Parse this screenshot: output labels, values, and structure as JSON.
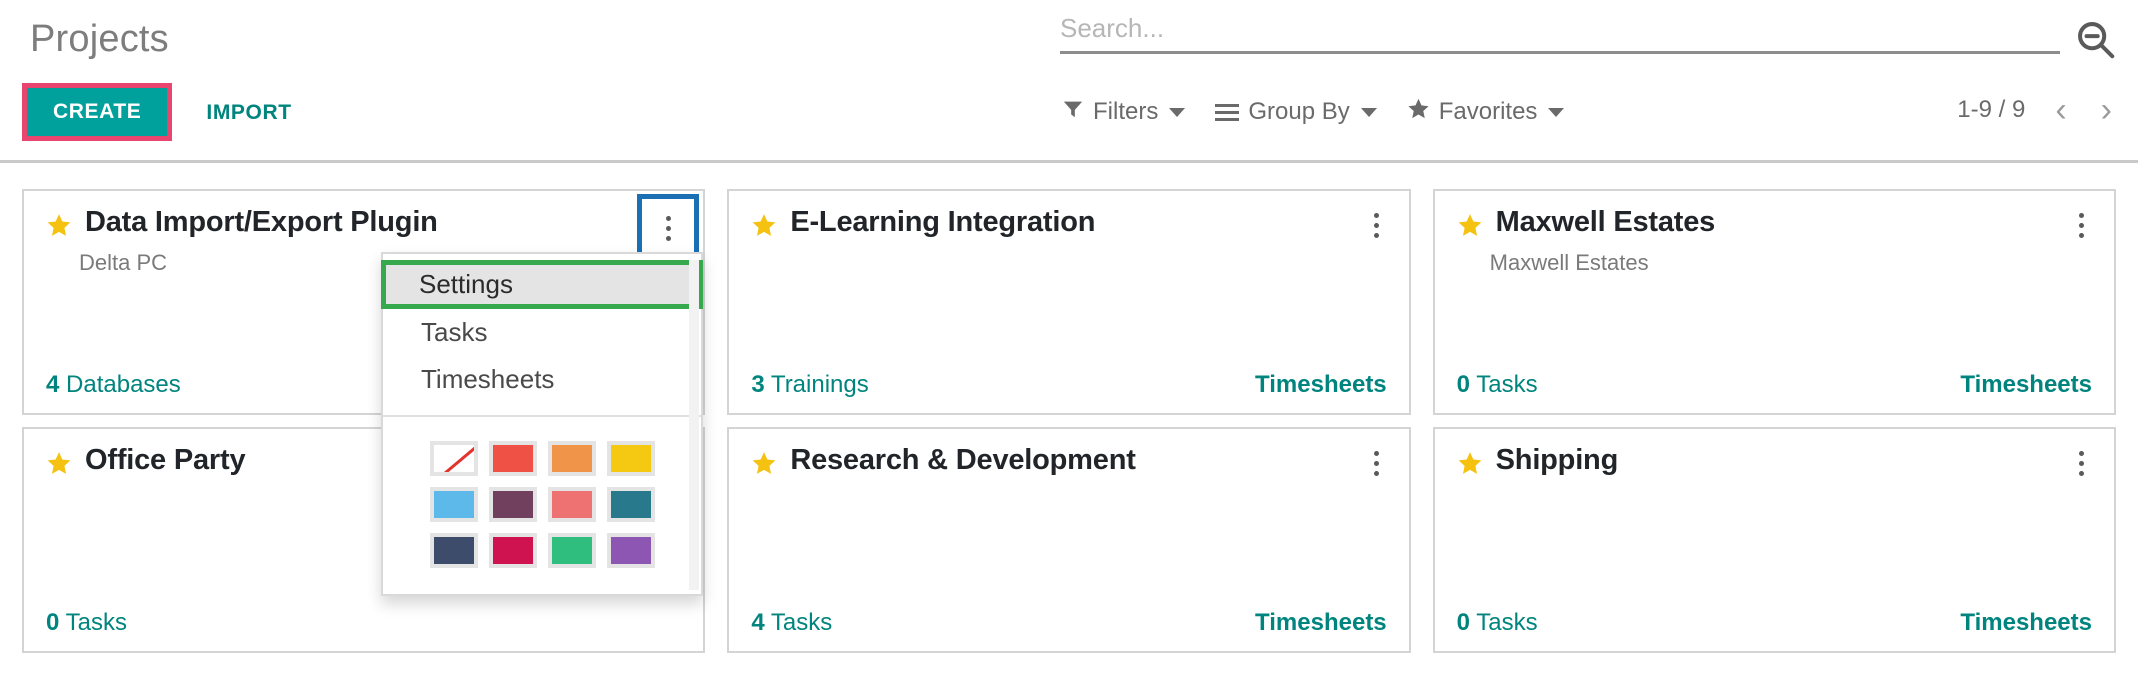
{
  "header": {
    "title": "Projects",
    "create_label": "CREATE",
    "import_label": "IMPORT"
  },
  "search": {
    "value": "",
    "placeholder": "Search...",
    "icon": "search-minus-icon"
  },
  "filters": [
    {
      "label": "Filters",
      "icon": "funnel-icon"
    },
    {
      "label": "Group By",
      "icon": "list-icon"
    },
    {
      "label": "Favorites",
      "icon": "star-icon"
    }
  ],
  "pager": {
    "count": "1-9 / 9",
    "prev": "‹",
    "next": "›"
  },
  "cards": [
    {
      "title": "Data Import/Export Plugin",
      "subtitle": "Delta PC",
      "stat_value": "4",
      "stat_label": "Databases",
      "timesheets": "",
      "favorite": true,
      "menu_open": true
    },
    {
      "title": "E-Learning Integration",
      "subtitle": "",
      "stat_value": "3",
      "stat_label": "Trainings",
      "timesheets": "Timesheets",
      "favorite": true,
      "menu_open": false
    },
    {
      "title": "Maxwell Estates",
      "subtitle": "Maxwell Estates",
      "stat_value": "0",
      "stat_label": "Tasks",
      "timesheets": "Timesheets",
      "favorite": true,
      "menu_open": false
    },
    {
      "title": "Office Party",
      "subtitle": "",
      "stat_value": "0",
      "stat_label": "Tasks",
      "timesheets": "",
      "favorite": true,
      "menu_open": false
    },
    {
      "title": "Research & Development",
      "subtitle": "",
      "stat_value": "4",
      "stat_label": "Tasks",
      "timesheets": "Timesheets",
      "favorite": true,
      "menu_open": false
    },
    {
      "title": "Shipping",
      "subtitle": "",
      "stat_value": "0",
      "stat_label": "Tasks",
      "timesheets": "Timesheets",
      "favorite": true,
      "menu_open": false
    }
  ],
  "dropdown": {
    "items": [
      {
        "label": "Settings",
        "active": true
      },
      {
        "label": "Tasks",
        "active": false
      },
      {
        "label": "Timesheets",
        "active": false
      }
    ],
    "colors": [
      "none",
      "#ef5145",
      "#ef9448",
      "#f5c811",
      "#5cb9ea",
      "#71405f",
      "#ef7272",
      "#29798c",
      "#3d4c6b",
      "#cf1351",
      "#2fbe7d",
      "#8e56b3"
    ]
  },
  "highlight_colors": {
    "create_button": "#e8466e",
    "kebab_button": "#1a6fb5",
    "settings_item": "#35a94b"
  }
}
